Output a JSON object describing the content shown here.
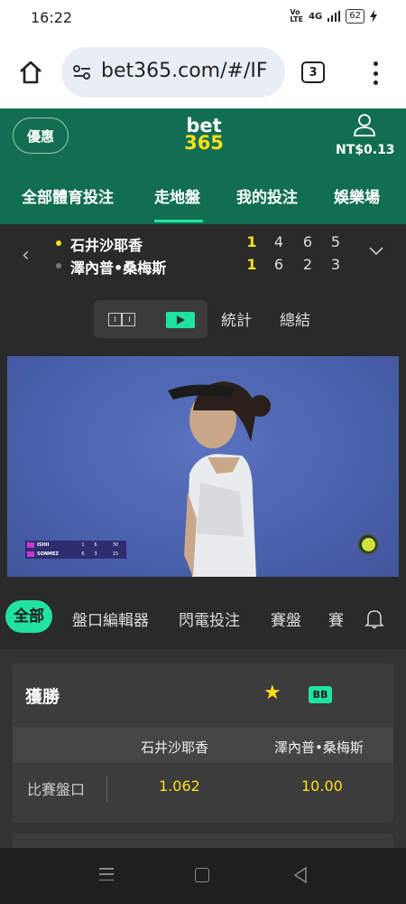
{
  "status_bar": {
    "time": "16:22",
    "network": "4G",
    "battery": "62"
  },
  "browser": {
    "url": "bet365.com/#/IF",
    "tab_count": "3"
  },
  "header": {
    "promo_label": "優惠",
    "logo_top": "bet",
    "logo_bottom": "365",
    "balance": "NT$0.13",
    "nav": [
      "全部體育投注",
      "走地盤",
      "我的投注",
      "娛樂場"
    ],
    "active_nav_index": 1
  },
  "match": {
    "players": [
      {
        "name": "石井沙耶香",
        "scores": [
          "1",
          "4",
          "6",
          "5"
        ],
        "serving": true,
        "dot_color": "#ffdf1b"
      },
      {
        "name": "澤內普•桑梅斯",
        "scores": [
          "1",
          "6",
          "2",
          "3"
        ],
        "serving": false,
        "dot_color": "#777777"
      }
    ]
  },
  "media": {
    "links": [
      "統計",
      "總結"
    ]
  },
  "video_overlay": {
    "rows": [
      {
        "name": "ISHII",
        "g1": "1",
        "g2": "6",
        "g3": "30"
      },
      {
        "name": "SONMEZ",
        "g1": "6",
        "g2": "3",
        "g3": "15"
      }
    ]
  },
  "market_tabs": [
    "全部",
    "盤口編輯器",
    "閃電投注",
    "賽盤",
    "賽"
  ],
  "market": {
    "title": "獲勝",
    "bb_label": "BB",
    "columns": [
      "石井沙耶香",
      "澤內普•桑梅斯"
    ],
    "row_label": "比賽盤口",
    "odds": [
      "1.062",
      "10.00"
    ]
  },
  "colors": {
    "brand_green": "#126e51",
    "accent": "#20e3a2",
    "odds_yellow": "#ffdf1b",
    "dark_bg": "#2a2a2a"
  }
}
